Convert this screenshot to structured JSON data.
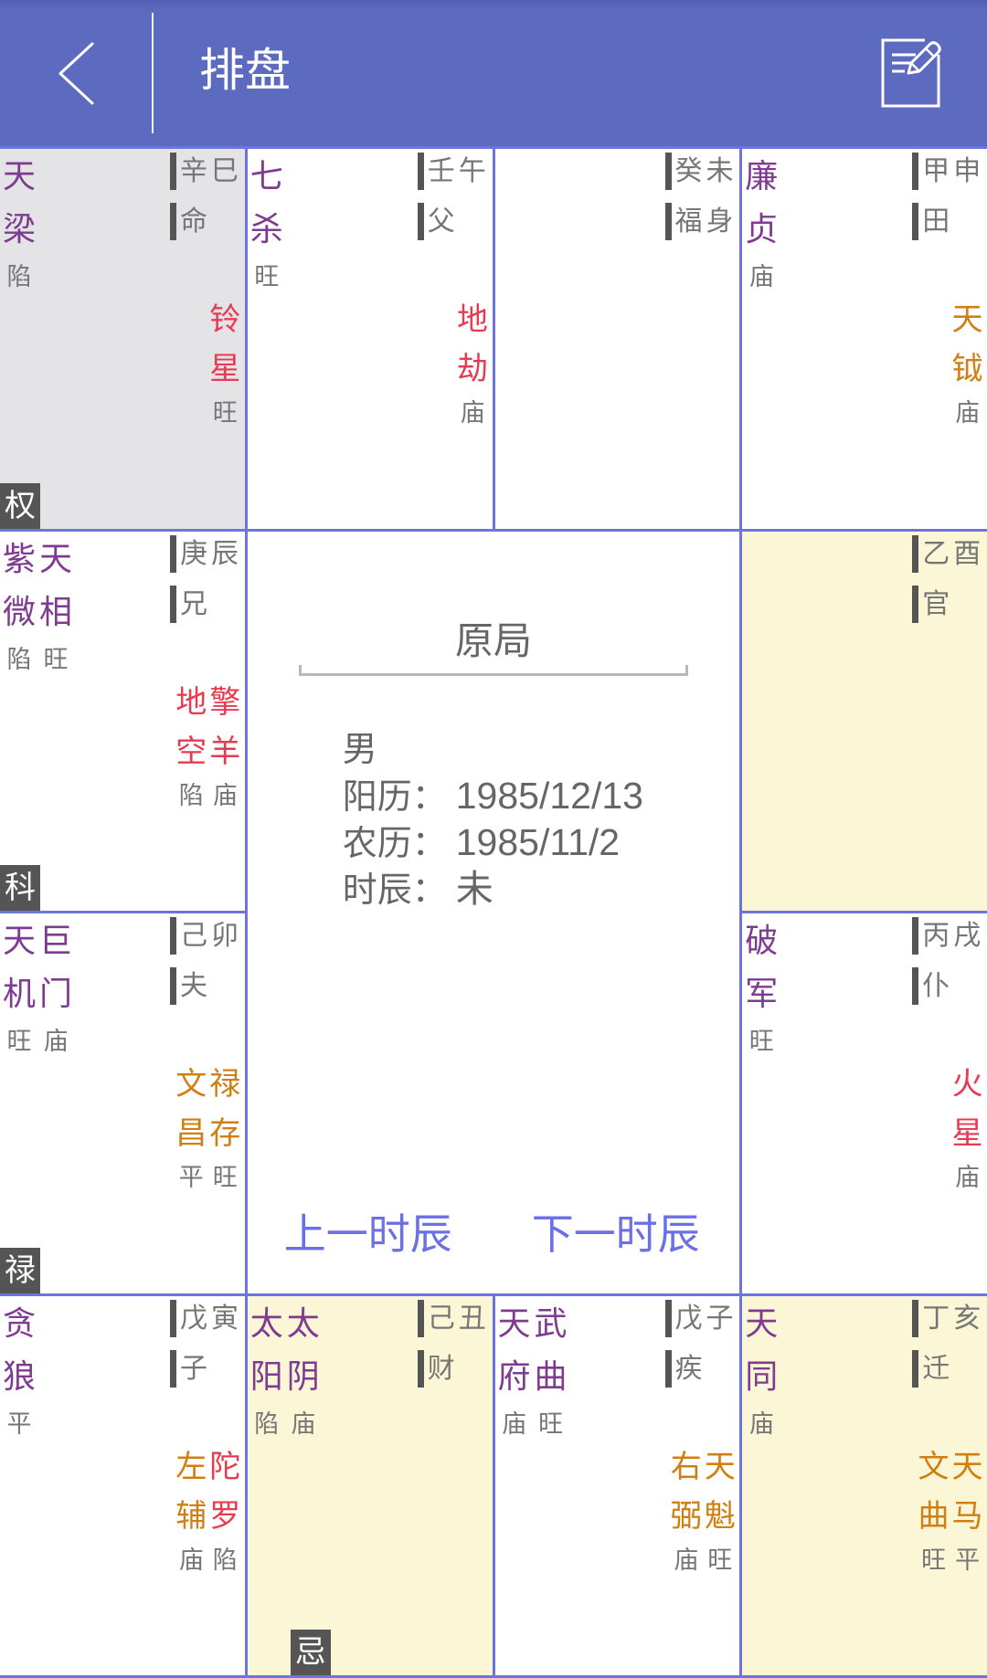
{
  "header": {
    "title": "排盘",
    "back_icon": "chevron-left-icon",
    "edit_icon": "edit-note-icon"
  },
  "colors": {
    "header": "#5c6bc0",
    "grid": "#6c74de",
    "main": "#7e3b90",
    "malefic": "#e83a50",
    "benefic": "#d07f12",
    "dim": "#767676",
    "bar": "#555555",
    "sel": "#e4e3e6",
    "sf": "#fbf6d6",
    "center": "#666666",
    "link": "#6b70e6"
  },
  "palaces": [
    {
      "branch": "巳",
      "ganzhi": "辛巳",
      "palace": "命",
      "highlight": "selected",
      "main_stars": [
        {
          "name": "天梁",
          "brightness": "陷"
        }
      ],
      "minor_stars": [
        {
          "name": "铃星",
          "brightness": "旺",
          "kind": "malefic"
        }
      ],
      "sihua": {
        "label": "权",
        "star_index": 0
      }
    },
    {
      "branch": "午",
      "ganzhi": "壬午",
      "palace": "父",
      "highlight": "none",
      "main_stars": [
        {
          "name": "七杀",
          "brightness": "旺"
        }
      ],
      "minor_stars": [
        {
          "name": "地劫",
          "brightness": "庙",
          "kind": "malefic"
        }
      ]
    },
    {
      "branch": "未",
      "ganzhi": "癸未",
      "palace": "福身",
      "highlight": "none",
      "main_stars": [],
      "minor_stars": []
    },
    {
      "branch": "申",
      "ganzhi": "甲申",
      "palace": "田",
      "highlight": "none",
      "main_stars": [
        {
          "name": "廉贞",
          "brightness": "庙"
        }
      ],
      "minor_stars": [
        {
          "name": "天钺",
          "brightness": "庙",
          "kind": "benefic"
        }
      ]
    },
    {
      "branch": "辰",
      "ganzhi": "庚辰",
      "palace": "兄",
      "highlight": "none",
      "main_stars": [
        {
          "name": "紫微",
          "brightness": "陷"
        },
        {
          "name": "天相",
          "brightness": "旺"
        }
      ],
      "minor_stars": [
        {
          "name": "地空",
          "brightness": "陷",
          "kind": "malefic"
        },
        {
          "name": "擎羊",
          "brightness": "庙",
          "kind": "malefic"
        }
      ],
      "sihua": {
        "label": "科",
        "star_index": 0
      }
    },
    {
      "branch": "酉",
      "ganzhi": "乙酉",
      "palace": "官",
      "highlight": "sanfang",
      "main_stars": [],
      "minor_stars": []
    },
    {
      "branch": "卯",
      "ganzhi": "己卯",
      "palace": "夫",
      "highlight": "none",
      "main_stars": [
        {
          "name": "天机",
          "brightness": "旺"
        },
        {
          "name": "巨门",
          "brightness": "庙"
        }
      ],
      "minor_stars": [
        {
          "name": "文昌",
          "brightness": "平",
          "kind": "benefic"
        },
        {
          "name": "禄存",
          "brightness": "旺",
          "kind": "benefic"
        }
      ],
      "sihua": {
        "label": "禄",
        "star_index": 0
      }
    },
    {
      "branch": "戌",
      "ganzhi": "丙戌",
      "palace": "仆",
      "highlight": "none",
      "main_stars": [
        {
          "name": "破军",
          "brightness": "旺"
        }
      ],
      "minor_stars": [
        {
          "name": "火星",
          "brightness": "庙",
          "kind": "malefic"
        }
      ]
    },
    {
      "branch": "寅",
      "ganzhi": "戊寅",
      "palace": "子",
      "highlight": "none",
      "main_stars": [
        {
          "name": "贪狼",
          "brightness": "平"
        }
      ],
      "minor_stars": [
        {
          "name": "左辅",
          "brightness": "庙",
          "kind": "benefic"
        },
        {
          "name": "陀罗",
          "brightness": "陷",
          "kind": "malefic"
        }
      ]
    },
    {
      "branch": "丑",
      "ganzhi": "己丑",
      "palace": "财",
      "highlight": "sanfang",
      "main_stars": [
        {
          "name": "太阳",
          "brightness": "陷"
        },
        {
          "name": "太阴",
          "brightness": "庙"
        }
      ],
      "minor_stars": [],
      "sihua": {
        "label": "忌",
        "star_index": 1
      }
    },
    {
      "branch": "子",
      "ganzhi": "戊子",
      "palace": "疾",
      "highlight": "none",
      "main_stars": [
        {
          "name": "天府",
          "brightness": "庙"
        },
        {
          "name": "武曲",
          "brightness": "旺"
        }
      ],
      "minor_stars": [
        {
          "name": "右弼",
          "brightness": "庙",
          "kind": "benefic"
        },
        {
          "name": "天魁",
          "brightness": "旺",
          "kind": "benefic"
        }
      ]
    },
    {
      "branch": "亥",
      "ganzhi": "丁亥",
      "palace": "迁",
      "highlight": "sanfang",
      "main_stars": [
        {
          "name": "天同",
          "brightness": "庙"
        }
      ],
      "minor_stars": [
        {
          "name": "文曲",
          "brightness": "旺",
          "kind": "benefic"
        },
        {
          "name": "天马",
          "brightness": "平",
          "kind": "benefic"
        }
      ]
    }
  ],
  "center": {
    "title": "原局",
    "gender": "男",
    "rows": [
      {
        "label": "阳历：",
        "value": "1985/12/13"
      },
      {
        "label": "农历：",
        "value": "1985/11/2"
      },
      {
        "label": "时辰：",
        "value": "未"
      }
    ],
    "prev_label": "上一时辰",
    "next_label": "下一时辰"
  }
}
